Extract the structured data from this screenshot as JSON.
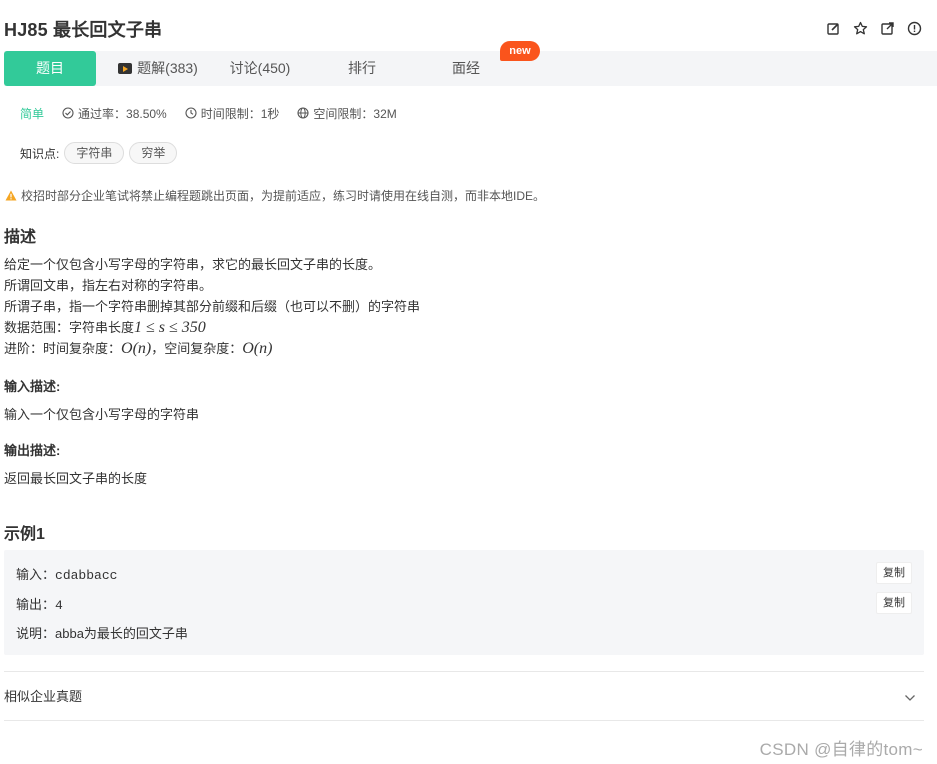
{
  "header": {
    "title": "HJ85  最长回文子串",
    "icons": [
      "edit-icon",
      "star-icon",
      "share-icon",
      "report-icon"
    ]
  },
  "tabs": [
    {
      "label": "题目",
      "active": true
    },
    {
      "label": "题解(383)",
      "icon": "video-icon"
    },
    {
      "label": "讨论(450)"
    },
    {
      "label": "排行"
    },
    {
      "label": "面经"
    }
  ],
  "new_badge": "new",
  "meta": {
    "difficulty": "简单",
    "pass_rate": "通过率：38.50%",
    "time_limit": "时间限制：1秒",
    "space_limit": "空间限制：32M"
  },
  "knowledge": {
    "label": "知识点:",
    "tags": [
      "字符串",
      "穷举"
    ]
  },
  "warning": "校招时部分企业笔试将禁止编程题跳出页面，为提前适应，练习时请使用在线自测，而非本地IDE。",
  "description": {
    "heading": "描述",
    "lines": [
      "给定一个仅包含小写字母的字符串，求它的最长回文子串的长度。",
      "所谓回文串，指左右对称的字符串。",
      "所谓子串，指一个字符串删掉其部分前缀和后缀（也可以不删）的字符串"
    ],
    "range_prefix": "数据范围：字符串长度",
    "range_math": "1 ≤ s ≤ 350",
    "advanced_prefix": "进阶：时间复杂度：",
    "advanced_time": "O(n)",
    "advanced_mid": "，空间复杂度：",
    "advanced_space": "O(n)"
  },
  "input_desc": {
    "heading": "输入描述:",
    "text": "输入一个仅包含小写字母的字符串"
  },
  "output_desc": {
    "heading": "输出描述:",
    "text": "返回最长回文子串的长度"
  },
  "example": {
    "heading": "示例1",
    "input_label": "输入：",
    "input_value": "cdabbacc",
    "output_label": "输出：",
    "output_value": "4",
    "explain_label": "说明：",
    "explain_value": "abba为最长的回文子串",
    "copy_label": "复制"
  },
  "similar": {
    "label": "相似企业真题"
  },
  "watermark": "CSDN @自律的tom~",
  "colors": {
    "accent": "#32ca99",
    "badge": "#fa541c",
    "warn": "#f5a623"
  }
}
